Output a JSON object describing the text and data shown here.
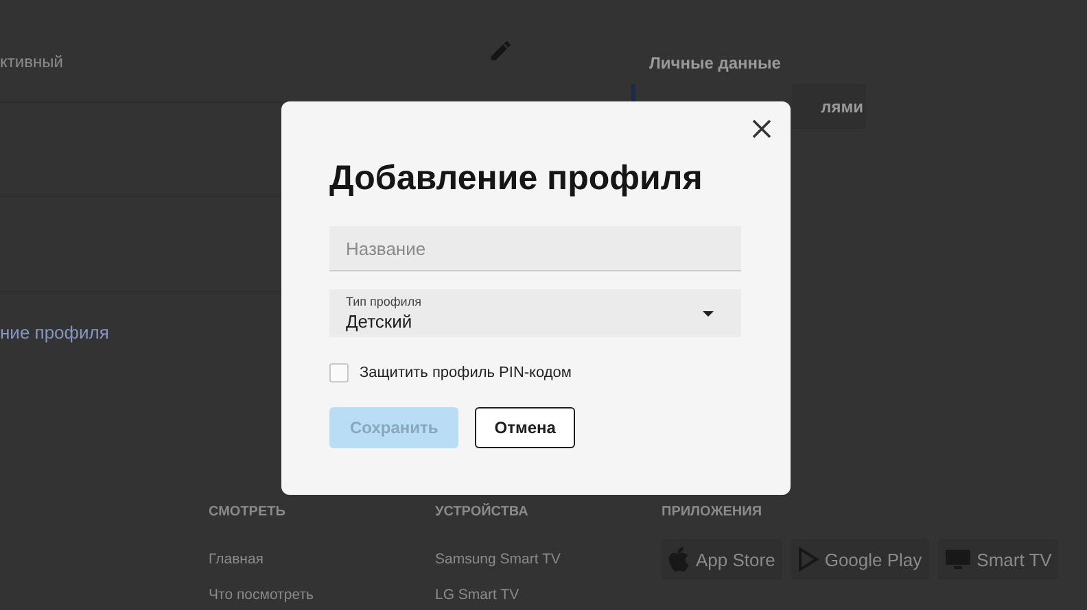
{
  "background": {
    "profile_row": {
      "text": "ктивный"
    },
    "link": "ние профиля",
    "side": {
      "heading": "Личные данные",
      "tab_text": "лями"
    },
    "footer": {
      "columns": [
        {
          "heading": "СМОТРЕТЬ",
          "links": [
            "Главная",
            "Что посмотреть"
          ]
        },
        {
          "heading": "УСТРОЙСТВА",
          "links": [
            "Samsung Smart TV",
            "LG Smart TV"
          ]
        },
        {
          "heading": "ПРИЛОЖЕНИЯ",
          "badges": [
            {
              "kind": "apple",
              "label": "App Store"
            },
            {
              "kind": "play",
              "label": "Google Play"
            },
            {
              "kind": "tv",
              "label": "Smart TV"
            }
          ]
        }
      ]
    }
  },
  "dialog": {
    "title": "Добавление профиля",
    "fields": [
      {
        "kind": "text",
        "placeholder": "Название"
      },
      {
        "kind": "select",
        "label": "Тип профиля",
        "value": "Детский"
      }
    ],
    "checkbox": {
      "label": "Защитить профиль PIN-кодом",
      "checked": false
    },
    "buttons": [
      {
        "label": "Сохранить",
        "kind": "primary",
        "disabled": true
      },
      {
        "label": "Отмена",
        "kind": "secondary",
        "disabled": false
      }
    ]
  }
}
